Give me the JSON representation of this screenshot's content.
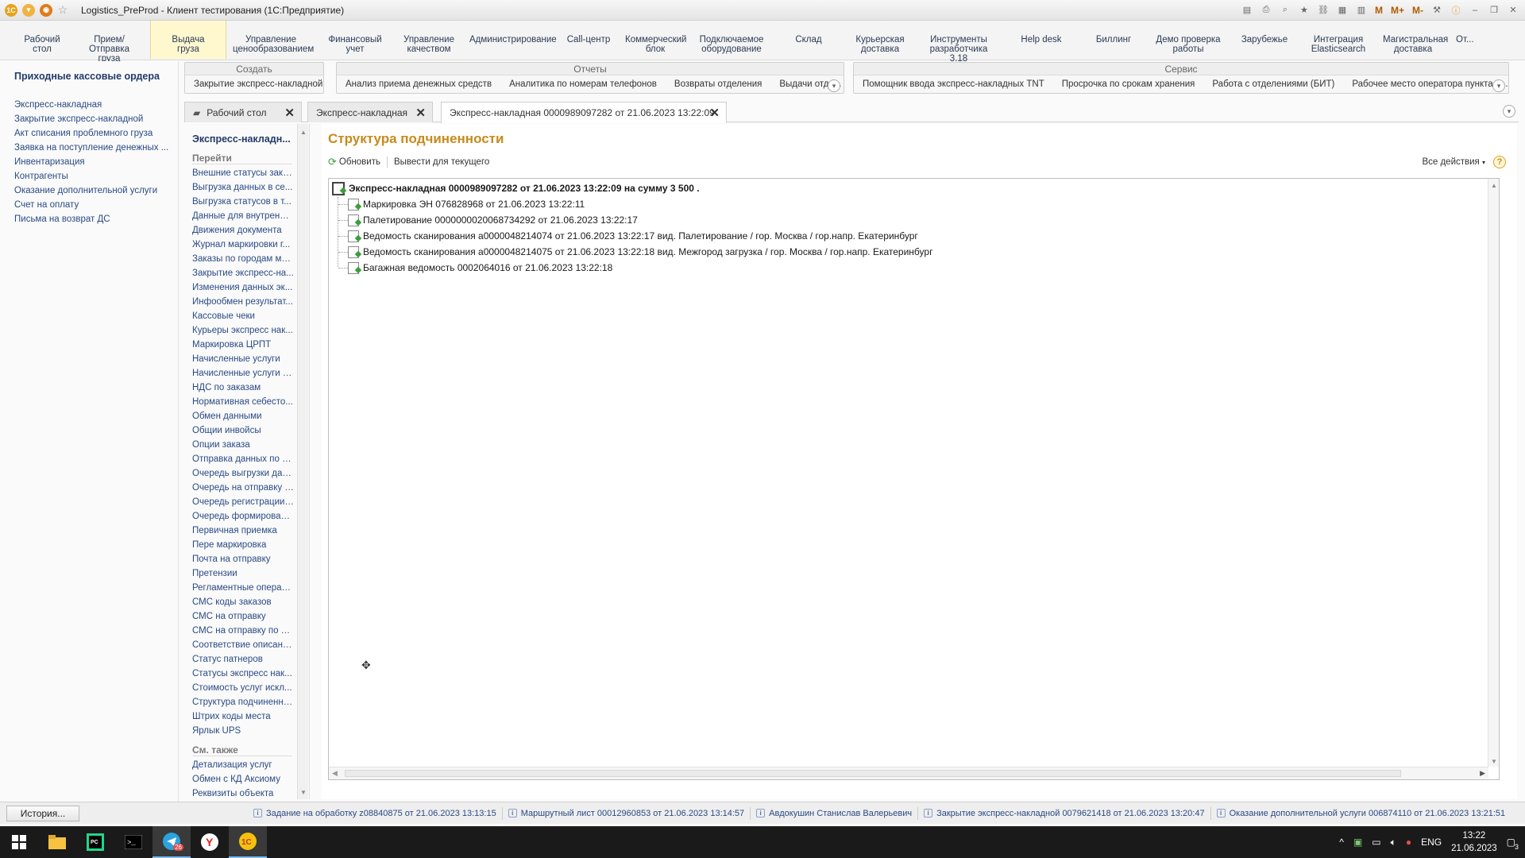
{
  "window": {
    "title": "Logistics_PreProd - Клиент тестирования (1С:Предприятие)",
    "toolbar_right": [
      "M",
      "M+",
      "M-"
    ]
  },
  "sections": [
    {
      "label": "Рабочий\nстол",
      "active": false
    },
    {
      "label": "Прием/Отправка\nгруза",
      "active": false
    },
    {
      "label": "Выдача\nгруза",
      "active": true
    },
    {
      "label": "Управление\nценообразованием",
      "active": false
    },
    {
      "label": "Финансовый\nучет",
      "active": false
    },
    {
      "label": "Управление\nкачеством",
      "active": false
    },
    {
      "label": "Администрирование",
      "active": false
    },
    {
      "label": "Call-центр",
      "active": false
    },
    {
      "label": "Коммерческий\nблок",
      "active": false
    },
    {
      "label": "Подключаемое\nоборудование",
      "active": false
    },
    {
      "label": "Склад",
      "active": false
    },
    {
      "label": "Курьерская\nдоставка",
      "active": false
    },
    {
      "label": "Инструменты\nразработчика 3.18",
      "active": false
    },
    {
      "label": "Help desk",
      "active": false
    },
    {
      "label": "Биллинг",
      "active": false
    },
    {
      "label": "Демо проверка\nработы",
      "active": false
    },
    {
      "label": "Зарубежье",
      "active": false
    },
    {
      "label": "Интеграция\nElasticsearch",
      "active": false
    },
    {
      "label": "Магистральная\nдоставка",
      "active": false
    },
    {
      "label": "От...",
      "active": false
    }
  ],
  "leftnav": {
    "header": "Приходные кассовые ордера",
    "items": [
      "Экспресс-накладная",
      "Закрытие экспресс-накладной",
      "Акт списания проблемного груза",
      "Заявка на поступление денежных ...",
      "Инвентаризация",
      "Контрагенты",
      "Оказание дополнительной услуги",
      "Счет на оплату",
      "Письма на возврат ДС"
    ]
  },
  "commands": {
    "create": {
      "header": "Создать",
      "items": [
        "Закрытие экспресс-накладной"
      ]
    },
    "reports": {
      "header": "Отчеты",
      "items": [
        "Анализ приема денежных средств",
        "Аналитика по номерам телефонов",
        "Возвраты отделения",
        "Выдачи отде..."
      ]
    },
    "service": {
      "header": "Сервис",
      "items": [
        "Помощник ввода экспресс-накладных TNT",
        "Просрочка по срокам хранения",
        "Работа с отделениями (БИТ)",
        "Рабочее место оператора пункта в..."
      ]
    }
  },
  "tabs": [
    {
      "label": "Рабочий стол",
      "active": false
    },
    {
      "label": "Экспресс-накладная",
      "active": false
    },
    {
      "label": "Экспресс-накладная 0000989097282 от 21.06.2023 13:22:09",
      "active": true
    }
  ],
  "innernav": {
    "header": "Экспресс-накладн...",
    "goto_label": "Перейти",
    "goto_items": [
      "Внешние статусы зака...",
      "Выгрузка данных в се...",
      "Выгрузка статусов в т...",
      "Данные для внутренни...",
      "Движения документа",
      "Журнал маркировки г...",
      "Заказы по городам ма...",
      "Закрытие экспресс-на...",
      "Изменения данных эк...",
      "Инфообмен результат...",
      "Кассовые чеки",
      "Курьеры экспресс нак...",
      "Маркировка ЦРПТ",
      "Начисленные услуги",
      "Начисленные услуги (д...",
      "НДС по заказам",
      "Нормативная себесто...",
      "Обмен данными",
      "Общии инвойсы",
      "Опции заказа",
      "Отправка данных по с...",
      "Очередь выгрузки дан...",
      "Очередь на отправку д...",
      "Очередь регистрации ...",
      "Очередь формировани...",
      "Первичная приемка",
      "Пере маркировка",
      "Почта на отправку",
      "Претензии",
      "Регламентные операции",
      "СМС коды заказов",
      "СМС на отправку",
      "СМС на отправку по ус...",
      "Соответствие описани...",
      "Статус патнеров",
      "Статусы экспресс нак...",
      "Стоимость услуг искл...",
      "Структура подчиненно...",
      "Штрих коды места",
      "Ярлык UPS"
    ],
    "see_also_label": "См. также",
    "see_also_items": [
      "Детализация услуг",
      "Обмен с КД Аксиому",
      "Реквизиты объекта"
    ]
  },
  "main": {
    "title": "Структура подчиненности",
    "refresh_label": "Обновить",
    "output_current_label": "Вывести для текущего",
    "all_actions_label": "Все действия",
    "help_label": "?",
    "tree": {
      "root": "Экспресс-накладная 0000989097282 от 21.06.2023 13:22:09 на сумму 3 500 .",
      "children": [
        "Маркировка ЭН 076828968 от 21.06.2023 13:22:11",
        "Палетирование 0000000020068734292 от 21.06.2023 13:22:17",
        "Ведомость сканирования а0000048214074 от 21.06.2023 13:22:17  вид. Палетирование / гор. Москва / гор.напр. Екатеринбург",
        "Ведомость сканирования а0000048214075 от 21.06.2023 13:22:18  вид. Межгород загрузка / гор. Москва / гор.напр. Екатеринбург",
        "Багажная ведомость 0002064016 от 21.06.2023 13:22:18"
      ]
    }
  },
  "statusbar": {
    "history_label": "История...",
    "notifications": [
      "Задание на обработку z08840875 от 21.06.2023 13:13:15",
      "Маршрутный лист 00012960853 от 21.06.2023 13:14:57",
      "Авдокушин Станислав Валерьевич",
      "Закрытие экспресс-накладной 0079621418 от 21.06.2023 13:20:47",
      "Оказание дополнительной услуги 006874110 от 21.06.2023 13:21:51"
    ]
  },
  "taskbar": {
    "telegram_badge": "26",
    "language": "ENG",
    "time": "13:22",
    "date": "21.06.2023",
    "notification_count": "3"
  }
}
